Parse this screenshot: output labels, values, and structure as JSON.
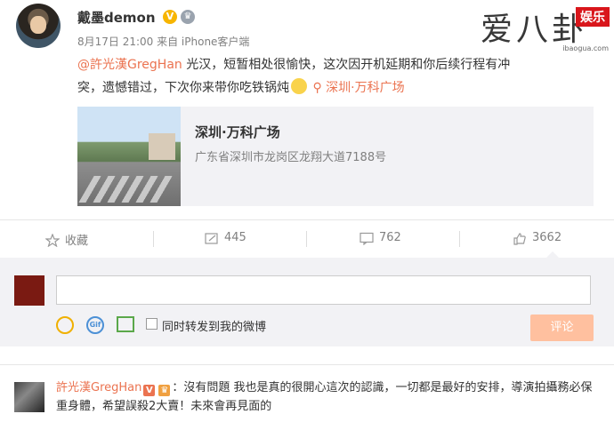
{
  "post": {
    "username": "戴墨demon",
    "verified_badge": "V",
    "meta": "8月17日 21:00 来自 iPhone客户端",
    "mention": "@許光漢GregHan",
    "text": " 光汉，短暂相处很愉快，这次因开机延期和你后续行程有冲突，遗憾错过，下次你来带你吃铁锅炖",
    "location_tag": "深圳·万科广场"
  },
  "watermark": {
    "main": "爱八卦",
    "badge": "娱乐",
    "url": "ibaogua.com"
  },
  "card": {
    "title": "深圳·万科广场",
    "address": "广东省深圳市龙岗区龙翔大道7188号"
  },
  "actions": {
    "collect": "收藏",
    "repost": "445",
    "comment": "762",
    "like": "3662"
  },
  "comment_box": {
    "input_value": "",
    "repost_checkbox_label": "同时转发到我的微博",
    "submit": "评论"
  },
  "reply": {
    "name": "許光漢GregHan",
    "text": "：沒有問題 我也是真的很開心這次的認識，一切都是最好的安排，導演拍攝務必保重身體，希望誤殺2大賣！未來會再見面的"
  },
  "colors": {
    "accent": "#eb7350",
    "muted": "#808080",
    "panel": "#f2f2f5"
  }
}
